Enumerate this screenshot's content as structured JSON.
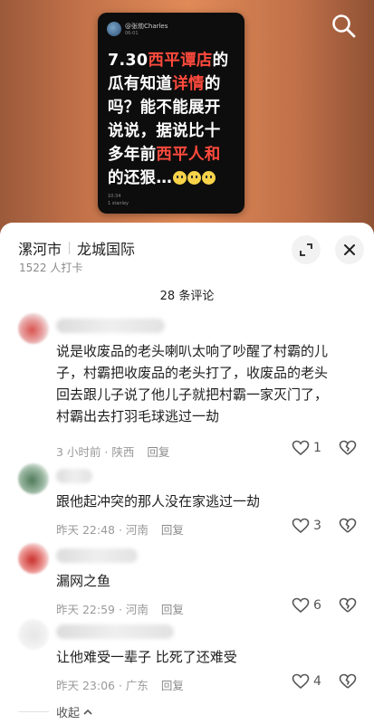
{
  "video": {
    "card_username": "@张勍Charles",
    "card_subline": "06-01",
    "card_text": {
      "line1_black": "7.30",
      "line1_red": "西平谭店",
      "line1_end": "的",
      "line2_black": "瓜有知道",
      "line2_red": "详情",
      "line2_end": "的",
      "line3": "吗？能不能展开",
      "line4": "说说，据说比十",
      "line5_black": "多年前",
      "line5_red": "西平人和",
      "line6": "的还狠…"
    },
    "card_footer_1": "10:34",
    "card_footer_2": "1 stanley"
  },
  "sheet": {
    "location_city": "漯河市",
    "location_place": "龙城国际",
    "checkin_count": "1522 人打卡",
    "comment_count": "28 条评论"
  },
  "comments": [
    {
      "text": "说是收废品的老头喇叭太响了吵醒了村霸的儿子，村霸把收废品的老头打了，收废品的老头回去跟儿子说了他儿子就把村霸一家灭门了，村霸出去打羽毛球逃过一劫",
      "time": "3 小时前 · 陕西",
      "reply": "回复",
      "likes": "1"
    },
    {
      "text": "跟他起冲突的那人没在家逃过一劫",
      "time": "昨天 22:48 · 河南",
      "reply": "回复",
      "likes": "3"
    },
    {
      "text": "漏网之鱼",
      "time": "昨天 22:59 · 河南",
      "reply": "回复",
      "likes": "6"
    },
    {
      "text": "让他难受一辈子 比死了还难受",
      "time": "昨天 23:06 · 广东",
      "reply": "回复",
      "likes": "4"
    }
  ],
  "footer": {
    "collapse_label": "收起"
  },
  "icons": {
    "search": "search-icon",
    "expand": "expand-icon",
    "close": "close-icon",
    "like": "heart-icon",
    "dislike": "broken-heart-icon",
    "chevron": "chevron-up-icon"
  },
  "colors": {
    "accent_red": "#ff4a3d",
    "video_bg": "#e08a58",
    "card_bg": "#0d0d0d"
  }
}
